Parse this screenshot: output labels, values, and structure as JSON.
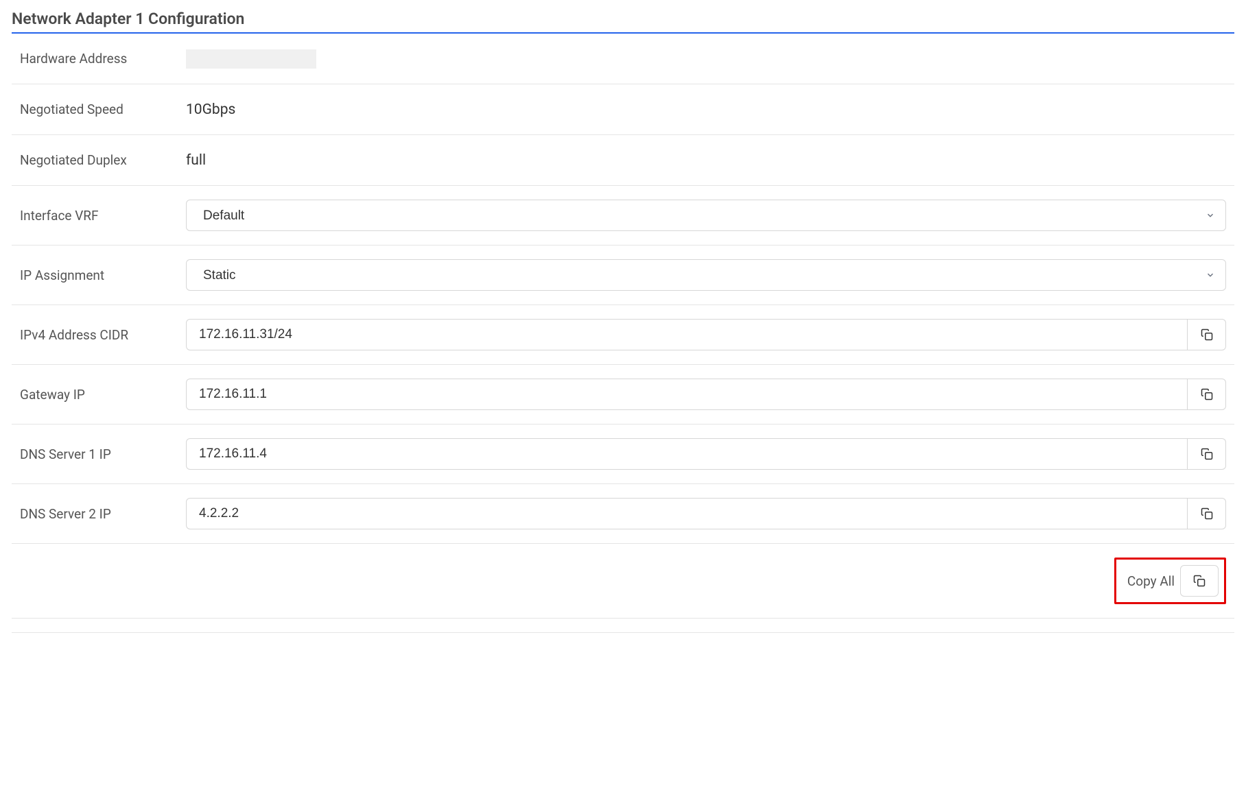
{
  "section": {
    "title": "Network Adapter 1 Configuration"
  },
  "fields": {
    "hardware_address": {
      "label": "Hardware Address",
      "value": ""
    },
    "negotiated_speed": {
      "label": "Negotiated Speed",
      "value": "10Gbps"
    },
    "negotiated_duplex": {
      "label": "Negotiated Duplex",
      "value": "full"
    },
    "interface_vrf": {
      "label": "Interface VRF",
      "value": "Default"
    },
    "ip_assignment": {
      "label": "IP Assignment",
      "value": "Static"
    },
    "ipv4_address_cidr": {
      "label": "IPv4 Address CIDR",
      "value": "172.16.11.31/24"
    },
    "gateway_ip": {
      "label": "Gateway IP",
      "value": "172.16.11.1"
    },
    "dns_server_1": {
      "label": "DNS Server 1 IP",
      "value": "172.16.11.4"
    },
    "dns_server_2": {
      "label": "DNS Server 2 IP",
      "value": "4.2.2.2"
    }
  },
  "actions": {
    "copy_all": "Copy All"
  }
}
